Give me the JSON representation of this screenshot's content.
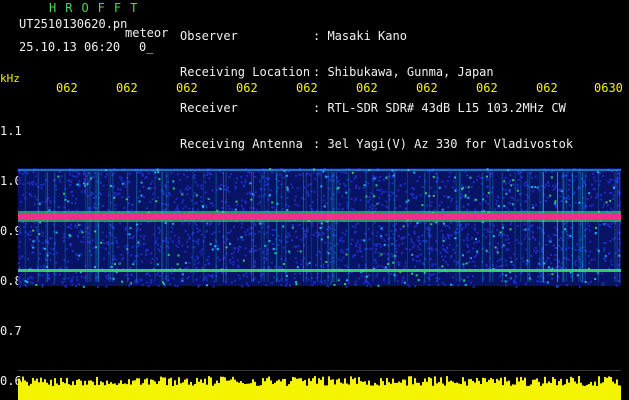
{
  "header": {
    "brand": "HROFFT",
    "filename": "UT2510130620.pn",
    "tag": "meteor",
    "datetime": "25.10.13 06:20",
    "count": "0_"
  },
  "meta": [
    {
      "label": "Observer",
      "value": ": Masaki Kano"
    },
    {
      "label": "Receiving Location",
      "value": ": Shibukawa, Gunma, Japan"
    },
    {
      "label": "Receiver",
      "value": ": RTL-SDR SDR# 43dB L15 103.2MHz CW"
    },
    {
      "label": "Receiving Antenna",
      "value": ": 3el Yagi(V) Az 330 for Vladivostok"
    }
  ],
  "axis": {
    "unit": "kHz",
    "time_ticks": [
      "062",
      "062",
      "062",
      "062",
      "062",
      "062",
      "062",
      "062",
      "062",
      "0630"
    ],
    "freq_ticks": [
      "1.1",
      "1.0",
      "0.9",
      "0.8",
      "0.7",
      "0.6"
    ]
  },
  "colors": {
    "background": "#000000",
    "noise_blue": "#1f2fd0",
    "signal_cyan": "#22d0ff",
    "signal_green": "#33ee66",
    "carrier_magenta": "#ff2f8f",
    "level_yellow": "#f4f400",
    "text_green": "#4fd84f"
  }
}
